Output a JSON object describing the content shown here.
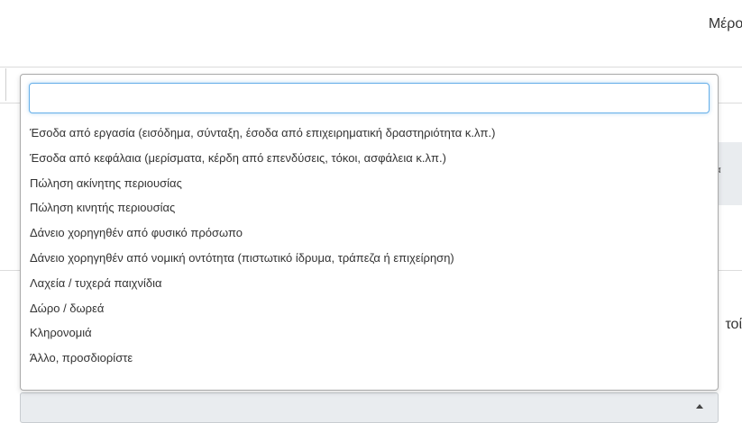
{
  "header": {
    "title_fragment": "Μέρος Ρευ"
  },
  "background": {
    "panel_fragment": "μα",
    "right_text_fragment": "τοί"
  },
  "dropdown": {
    "search_value": "",
    "options": [
      "Έσοδα από εργασία (εισόδημα, σύνταξη, έσοδα από επιχειρηματική δραστηριότητα κ.λπ.)",
      "Έσοδα από κεφάλαια (μερίσματα, κέρδη από επενδύσεις, τόκοι, ασφάλεια κ.λπ.)",
      "Πώληση ακίνητης περιουσίας",
      "Πώληση κινητής περιουσίας",
      "Δάνειο χορηγηθέν από φυσικό πρόσωπο",
      "Δάνειο χορηγηθέν από νομική οντότητα (πιστωτικό ίδρυμα, τράπεζα ή επιχείρηση)",
      "Λαχεία / τυχερά παιχνίδια",
      "Δώρο / δωρεά",
      "Κληρονομιά",
      "Άλλο, προσδιορίστε"
    ]
  },
  "select": {
    "selected_value": "",
    "arrow_icon": "caret-up-icon"
  },
  "colors": {
    "focus_border": "#66afe9",
    "panel_bg": "#e9ecef"
  }
}
